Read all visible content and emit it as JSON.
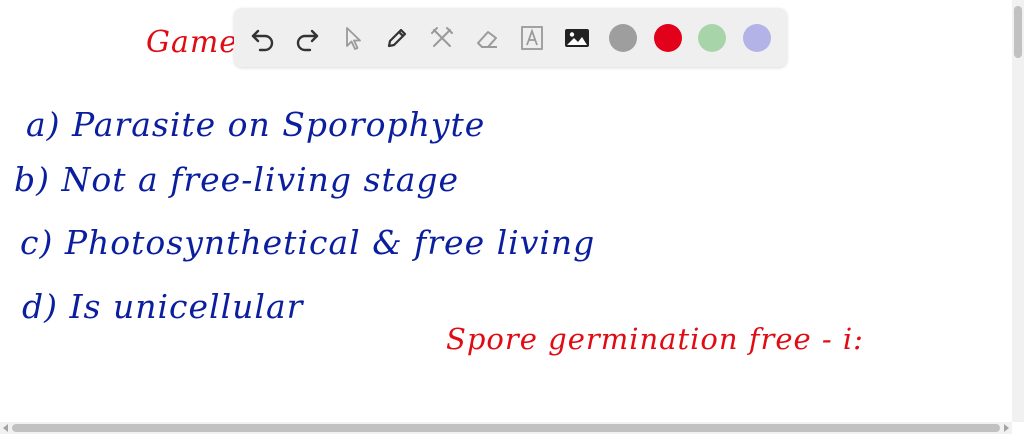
{
  "canvas": {
    "title_text": "Gametophyte ...",
    "options": [
      {
        "label": "a) Parasite on Sporophyte"
      },
      {
        "label": "b) Not a free-living stage"
      },
      {
        "label": "c) Photosynthetical & free living"
      },
      {
        "label": "d) Is unicellular"
      }
    ],
    "note_text": "Spore germination free - i:",
    "colors": {
      "ink_blue": "#0a1e9e",
      "ink_red": "#e10b14"
    }
  },
  "toolbar": {
    "tools": [
      {
        "icon": "undo-icon"
      },
      {
        "icon": "redo-icon"
      },
      {
        "icon": "cursor-icon"
      },
      {
        "icon": "pen-icon"
      },
      {
        "icon": "tools-icon"
      },
      {
        "icon": "eraser-icon"
      },
      {
        "icon": "text-icon"
      },
      {
        "icon": "image-icon"
      }
    ],
    "colors": [
      "#9e9e9e",
      "#e3001b",
      "#a7d4a9",
      "#b3b3e8"
    ]
  }
}
